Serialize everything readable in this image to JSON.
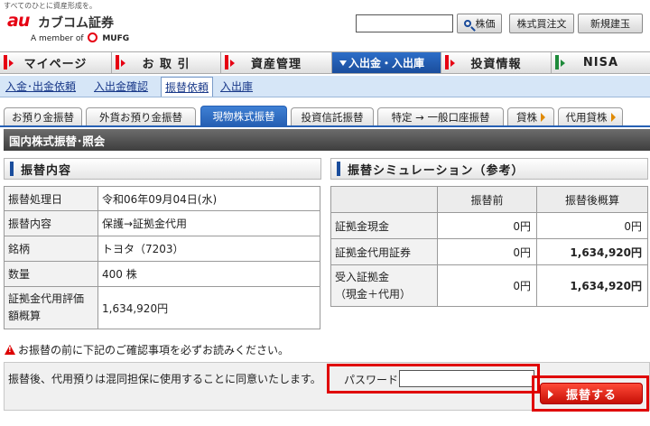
{
  "header": {
    "tagline": "すべてのひとに資産形成を。",
    "logo_au": "au",
    "logo_name": "カブコム証券",
    "logo_member_prefix": "A member of",
    "logo_member_brand": "MUFG",
    "search_placeholder": "",
    "search_button": "株価",
    "button_order": "株式買注文",
    "button_new": "新規建玉"
  },
  "main_nav": [
    {
      "label": "マイページ"
    },
    {
      "label": "お 取 引"
    },
    {
      "label": "資産管理"
    },
    {
      "label": "入出金・入出庫"
    },
    {
      "label": "投資情報"
    },
    {
      "label": "NISA"
    }
  ],
  "sub_nav": [
    {
      "label": "入金･出金依頼"
    },
    {
      "label": "入出金確認"
    },
    {
      "label": "振替依頼"
    },
    {
      "label": "入出庫"
    }
  ],
  "tabs": [
    {
      "label": "お預り金振替"
    },
    {
      "label": "外貨お預り金振替"
    },
    {
      "label": "現物株式振替"
    },
    {
      "label": "投資信託振替"
    },
    {
      "label": "特定 → 一般口座振替"
    },
    {
      "label": "貸株"
    },
    {
      "label": "代用貸株"
    }
  ],
  "section_title": "国内株式振替･照会",
  "transfer": {
    "title": "振替内容",
    "rows": [
      {
        "key": "振替処理日",
        "value": "令和06年09月04日(水)"
      },
      {
        "key": "振替内容",
        "value": "保護→証拠金代用"
      },
      {
        "key": "銘柄",
        "value": "トヨタ（7203）"
      },
      {
        "key": "数量",
        "value": "400 株"
      },
      {
        "key": "証拠金代用評価額概算",
        "value": "1,634,920円"
      }
    ]
  },
  "simulation": {
    "title": "振替シミュレーション（参考）",
    "col_before": "振替前",
    "col_after": "振替後概算",
    "rows": [
      {
        "key": "証拠金現金",
        "before": "0円",
        "after": "0円"
      },
      {
        "key": "証拠金代用証券",
        "before": "0円",
        "after": "1,634,920円"
      },
      {
        "key": "受入証拠金\n（現金＋代用）",
        "before": "0円",
        "after": "1,634,920円"
      }
    ]
  },
  "warning": "お振替の前に下記のご確認事項を必ずお読みください。",
  "consent": "振替後、代用預りは混同担保に使用することに同意いたします。",
  "password_label": "パスワード",
  "submit_label": "振替する",
  "colors": {
    "accent_red": "#e60012",
    "nav_active": "#1a4d9c",
    "section_bar": "#4a4a4a"
  }
}
